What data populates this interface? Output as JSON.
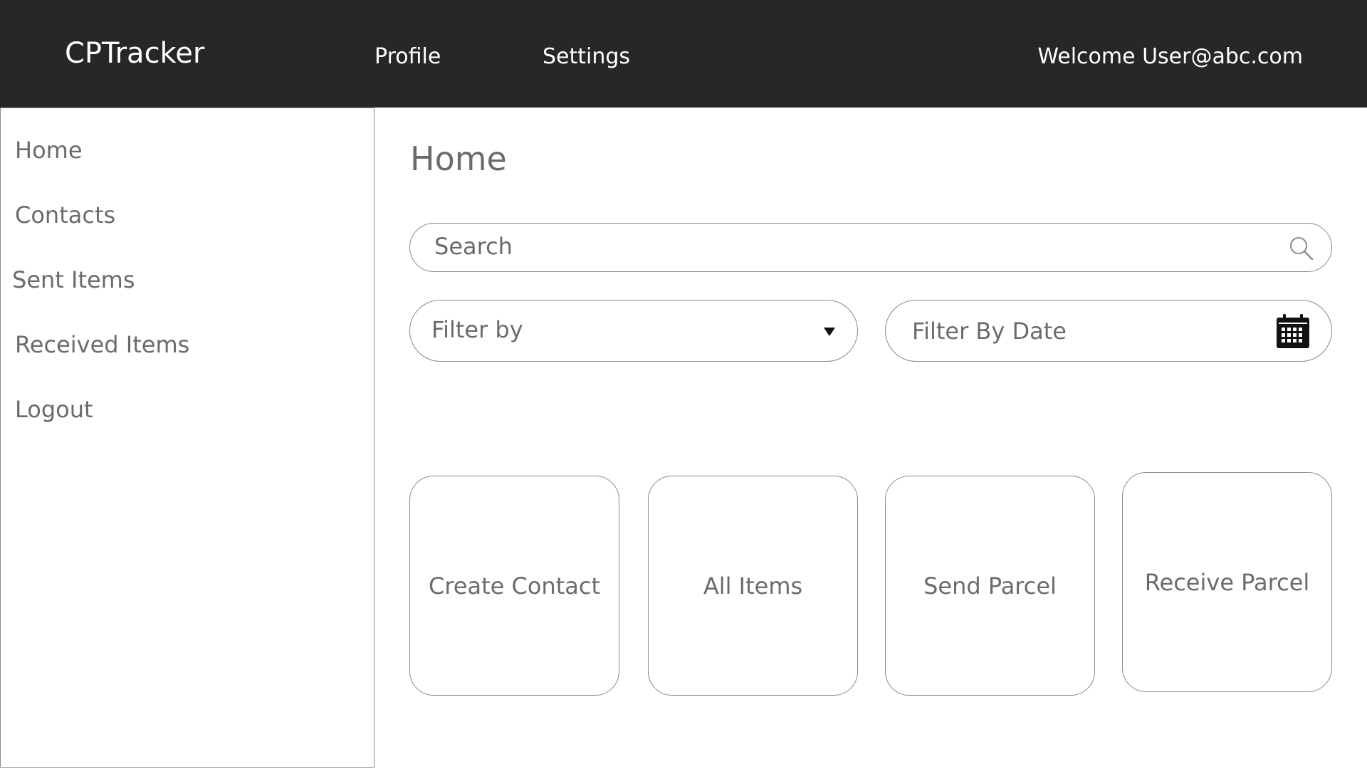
{
  "header": {
    "brand": "CPTracker",
    "nav": {
      "profile": "Profile",
      "settings": "Settings"
    },
    "welcome": "Welcome User@abc.com"
  },
  "sidebar": {
    "items": [
      {
        "label": "Home"
      },
      {
        "label": "Contacts"
      },
      {
        "label": "Sent Items"
      },
      {
        "label": "Received Items"
      },
      {
        "label": "Logout"
      }
    ]
  },
  "main": {
    "title": "Home",
    "search": {
      "placeholder": "Search",
      "icon": "search-icon"
    },
    "filter_by": {
      "value": "Filter by",
      "icon": "caret-down-icon"
    },
    "filter_date": {
      "value": "Filter By Date",
      "icon": "calendar-icon"
    },
    "cards": [
      {
        "label": "Create Contact"
      },
      {
        "label": "All Items"
      },
      {
        "label": "Send Parcel"
      },
      {
        "label": "Receive Parcel"
      }
    ]
  },
  "colors": {
    "header_bg": "#282726",
    "header_text": "#ffffff",
    "text": "#6b6b6b",
    "border": "#8a8a8a"
  }
}
